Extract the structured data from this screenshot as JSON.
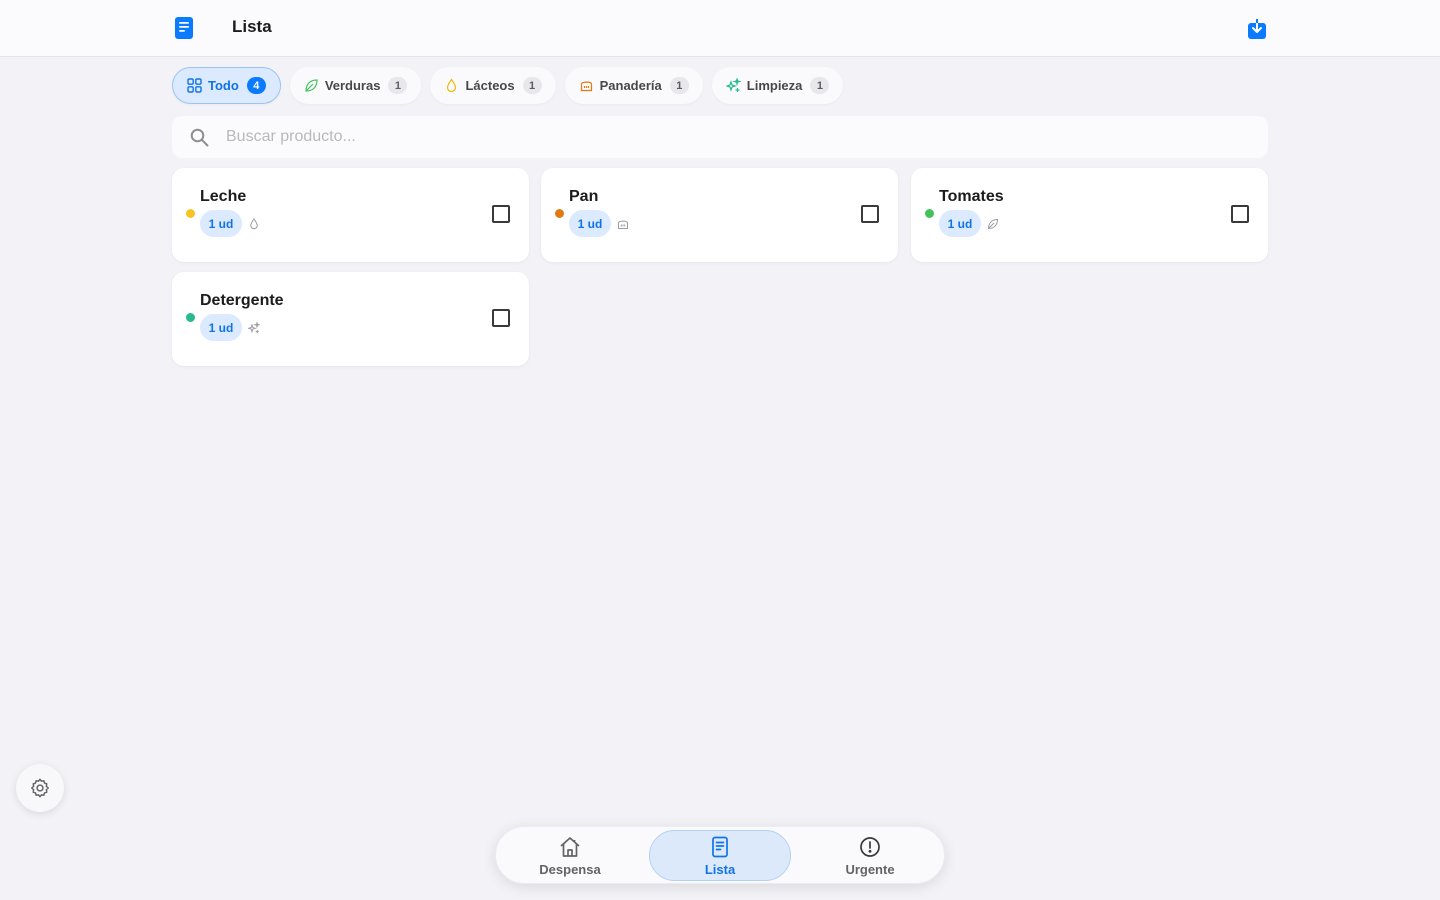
{
  "header": {
    "title": "Lista",
    "app_icon": "list-document-icon",
    "download_icon": "download-icon"
  },
  "filters": [
    {
      "label": "Todo",
      "count": "4",
      "icon": "grid-icon",
      "active": true
    },
    {
      "label": "Verduras",
      "count": "1",
      "icon": "leaf-icon",
      "active": false
    },
    {
      "label": "Lácteos",
      "count": "1",
      "icon": "drop-icon",
      "active": false
    },
    {
      "label": "Panadería",
      "count": "1",
      "icon": "bread-icon",
      "active": false
    },
    {
      "label": "Limpieza",
      "count": "1",
      "icon": "sparkles-icon",
      "active": false
    }
  ],
  "search": {
    "placeholder": "Buscar producto...",
    "value": ""
  },
  "items": [
    {
      "name": "Leche",
      "qty": "1 ud",
      "dot_color": "#f7c325",
      "category_icon": "drop-icon"
    },
    {
      "name": "Pan",
      "qty": "1 ud",
      "dot_color": "#e07b12",
      "category_icon": "bread-icon"
    },
    {
      "name": "Tomates",
      "qty": "1 ud",
      "dot_color": "#43c25a",
      "category_icon": "leaf-icon"
    },
    {
      "name": "Detergente",
      "qty": "1 ud",
      "dot_color": "#27b98f",
      "category_icon": "sparkles-icon"
    }
  ],
  "settings": {
    "icon": "gear-icon"
  },
  "tabs": [
    {
      "label": "Despensa",
      "icon": "house-icon",
      "active": false
    },
    {
      "label": "Lista",
      "icon": "list-document-icon",
      "active": true
    },
    {
      "label": "Urgente",
      "icon": "exclamation-circle-icon",
      "active": false
    }
  ],
  "colors": {
    "accent": "#0a7aff",
    "background": "#f2f2f7"
  }
}
